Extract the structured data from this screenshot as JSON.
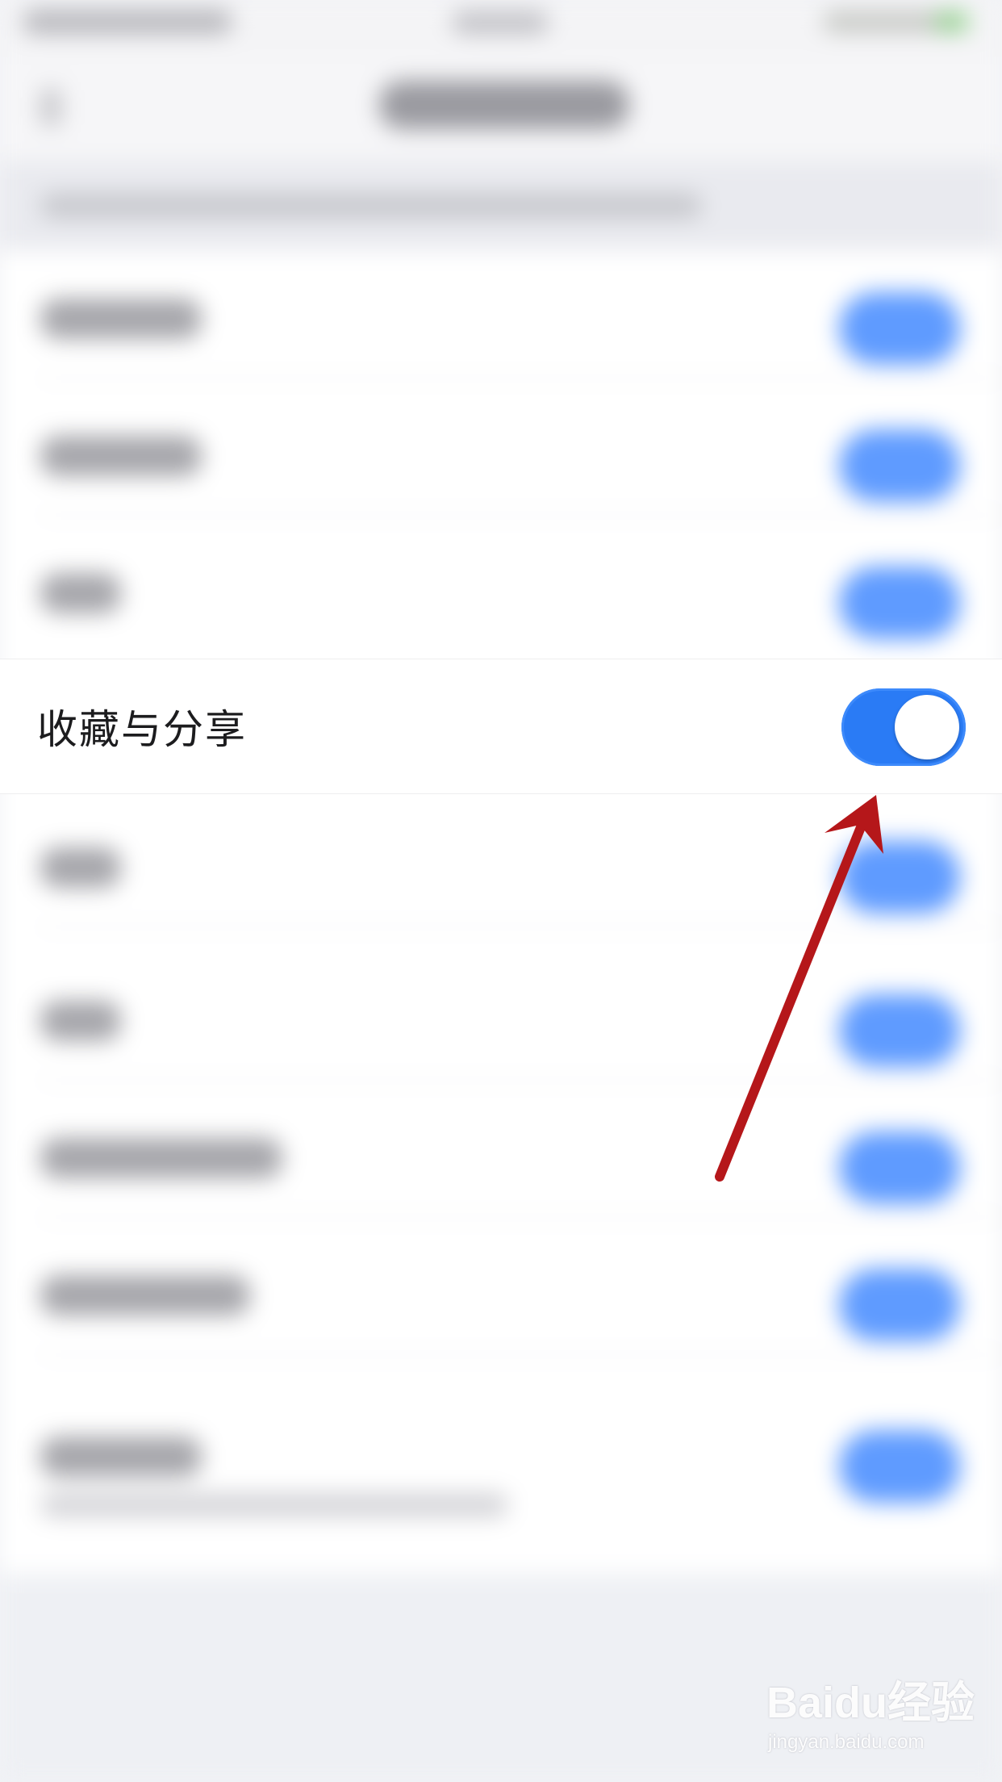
{
  "settings": {
    "highlighted_item": {
      "label": "收藏与分享",
      "toggle_state": "on"
    }
  },
  "watermark": {
    "brand": "Baidu经验",
    "url": "jingyan.baidu.com"
  },
  "colors": {
    "toggle_on": "#2a7bf5",
    "arrow": "#b5171a",
    "background": "#f2f3f6"
  }
}
